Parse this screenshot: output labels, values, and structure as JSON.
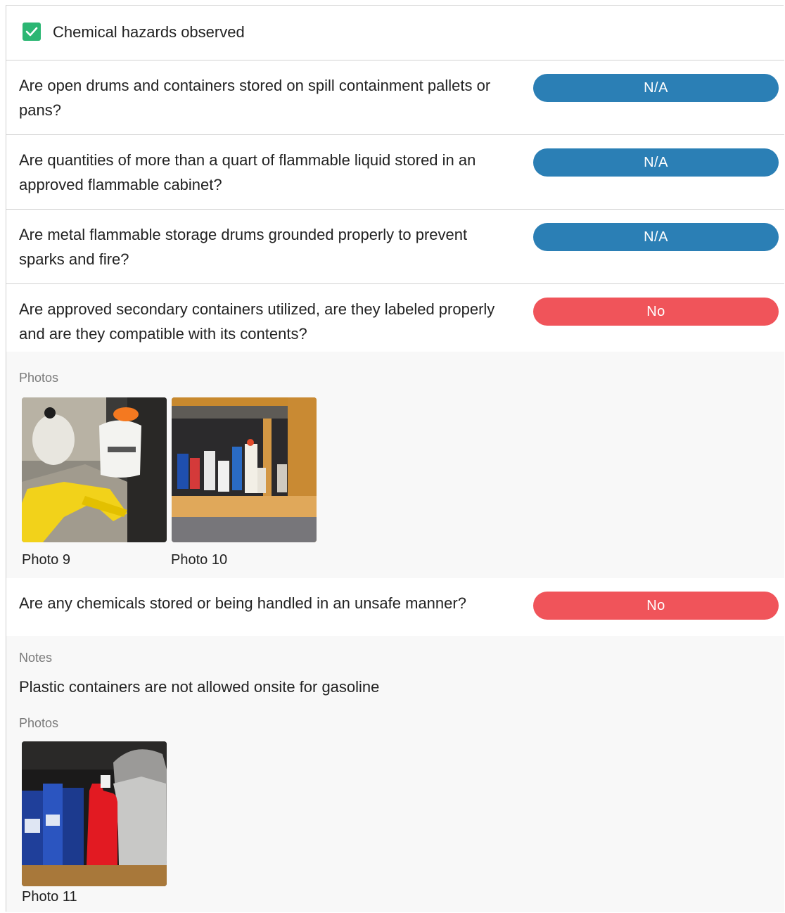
{
  "header": {
    "checkbox_checked": true,
    "label": "Chemical hazards observed"
  },
  "questions": [
    {
      "text": "Are open drums and containers stored on spill containment pallets or pans?",
      "answer": "N/A"
    },
    {
      "text": "Are quantities of more than a quart of flammable liquid stored in an approved flammable cabinet?",
      "answer": "N/A"
    },
    {
      "text": "Are metal flammable storage drums grounded properly to prevent sparks and fire?",
      "answer": "N/A"
    },
    {
      "text": "Are approved secondary containers utilized, are they labeled properly and are they compatible with its contents?",
      "answer": "No",
      "photos_label": "Photos",
      "photos": [
        {
          "caption": "Photo 9"
        },
        {
          "caption": "Photo 10"
        }
      ]
    },
    {
      "text": "Are any chemicals stored or being handled in an unsafe manner?",
      "answer": "No",
      "notes_label": "Notes",
      "notes": "Plastic containers are not allowed onsite for gasoline",
      "photos_label": "Photos",
      "photos": [
        {
          "caption": "Photo 11"
        }
      ]
    }
  ],
  "colors": {
    "na": "#2b7fb5",
    "no": "#f0545a",
    "check": "#2bb673"
  }
}
